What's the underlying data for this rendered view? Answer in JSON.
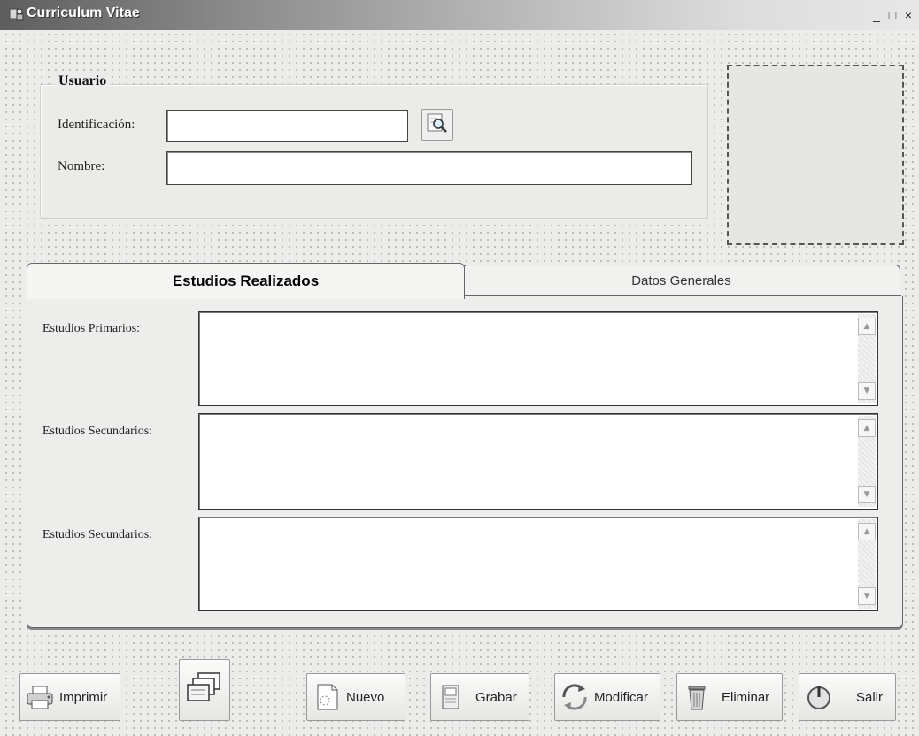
{
  "window": {
    "title": "Curriculum Vitae"
  },
  "controls": {
    "minimize": "_",
    "maximize": "□",
    "close": "×"
  },
  "user_group": {
    "legend": "Usuario",
    "id_label": "Identificación:",
    "id_value": "",
    "name_label": "Nombre:",
    "name_value": ""
  },
  "tabs": [
    {
      "label": "Estudios Realizados",
      "active": true
    },
    {
      "label": "Datos Generales",
      "active": false
    }
  ],
  "studies": [
    {
      "label": "Estudios Primarios:",
      "value": ""
    },
    {
      "label": "Estudios Secundarios:",
      "value": ""
    },
    {
      "label": "Estudios Secundarios:",
      "value": ""
    }
  ],
  "toolbar": {
    "print": "Imprimir",
    "new": "Nuevo",
    "save": "Grabar",
    "modify": "Modificar",
    "delete": "Eliminar",
    "exit": "Salir"
  },
  "icons": [
    "app-icon",
    "search-icon",
    "printer-icon",
    "windows-preview-icon",
    "new-document-icon",
    "save-document-icon",
    "modify-arrows-icon",
    "trash-icon",
    "power-icon"
  ]
}
